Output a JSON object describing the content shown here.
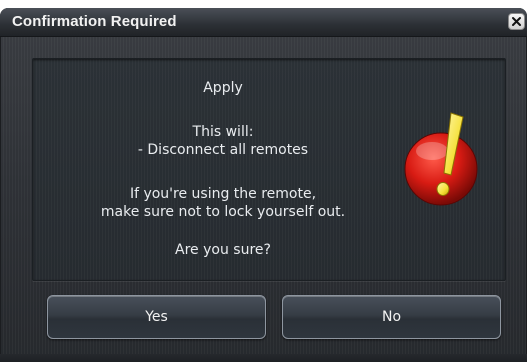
{
  "dialog": {
    "title": "Confirmation Required",
    "close_icon": "close-icon",
    "message": {
      "heading": "Apply",
      "line1": "This will:",
      "line2": "- Disconnect all remotes",
      "line3": "If you're using the remote,",
      "line4": "make sure not to lock yourself out.",
      "question": "Are you sure?"
    },
    "icon": "warning-exclamation-icon",
    "buttons": {
      "yes_label": "Yes",
      "no_label": "No"
    }
  },
  "colors": {
    "accent_red": "#d81b13",
    "accent_yellow": "#f5e13a",
    "dialog_bg": "#2e3136"
  }
}
